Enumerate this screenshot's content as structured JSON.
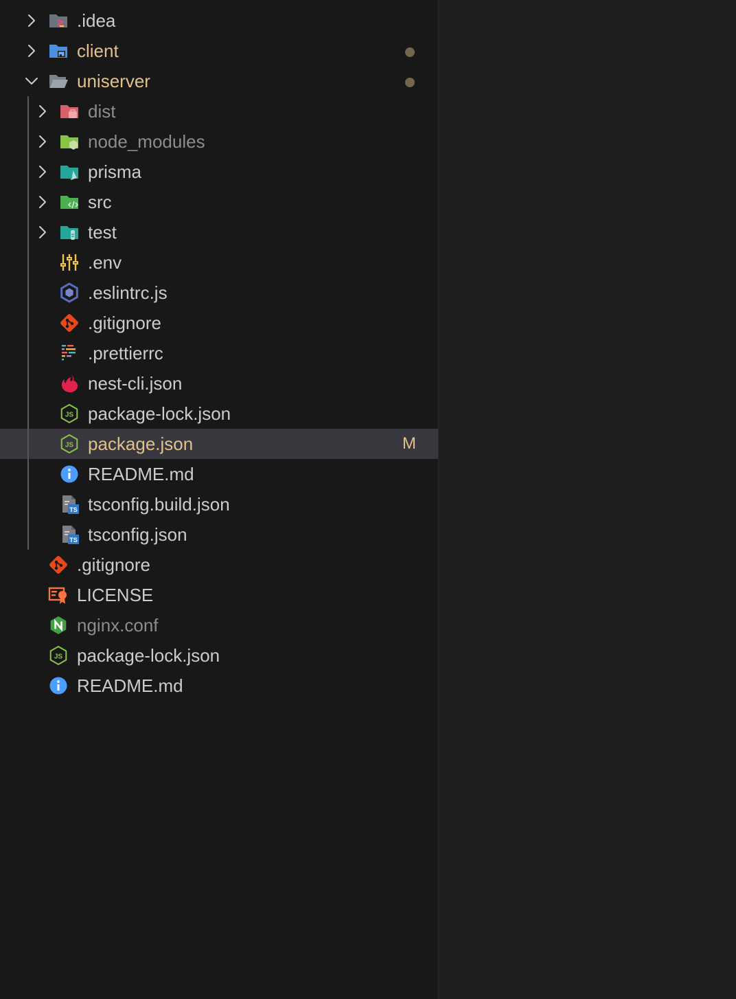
{
  "colors": {
    "sidebar_bg": "#181818",
    "editor_bg": "#1f1f1f",
    "selected_bg": "#37373d",
    "modified_text": "#e2c08d",
    "ignored_text": "#8c8c8c",
    "default_text": "#cccccc",
    "dot": "#73654c"
  },
  "explorer": {
    "items": [
      {
        "label": ".idea",
        "icon": "folder-idea-icon",
        "depth": 0,
        "folder": true,
        "expanded": false,
        "state": "normal"
      },
      {
        "label": "client",
        "icon": "folder-client-icon",
        "depth": 0,
        "folder": true,
        "expanded": false,
        "state": "modified",
        "decoration": "dot"
      },
      {
        "label": "uniserver",
        "icon": "folder-open-icon",
        "depth": 0,
        "folder": true,
        "expanded": true,
        "state": "modified",
        "decoration": "dot"
      },
      {
        "label": "dist",
        "icon": "folder-dist-icon",
        "depth": 1,
        "folder": true,
        "expanded": false,
        "state": "ignored"
      },
      {
        "label": "node_modules",
        "icon": "folder-node-icon",
        "depth": 1,
        "folder": true,
        "expanded": false,
        "state": "ignored"
      },
      {
        "label": "prisma",
        "icon": "folder-prisma-icon",
        "depth": 1,
        "folder": true,
        "expanded": false,
        "state": "normal"
      },
      {
        "label": "src",
        "icon": "folder-src-icon",
        "depth": 1,
        "folder": true,
        "expanded": false,
        "state": "normal"
      },
      {
        "label": "test",
        "icon": "folder-test-icon",
        "depth": 1,
        "folder": true,
        "expanded": false,
        "state": "normal"
      },
      {
        "label": ".env",
        "icon": "env-icon",
        "depth": 1,
        "folder": false,
        "state": "normal"
      },
      {
        "label": ".eslintrc.js",
        "icon": "eslint-icon",
        "depth": 1,
        "folder": false,
        "state": "normal"
      },
      {
        "label": ".gitignore",
        "icon": "git-icon",
        "depth": 1,
        "folder": false,
        "state": "normal"
      },
      {
        "label": ".prettierrc",
        "icon": "prettier-icon",
        "depth": 1,
        "folder": false,
        "state": "normal"
      },
      {
        "label": "nest-cli.json",
        "icon": "nest-icon",
        "depth": 1,
        "folder": false,
        "state": "normal"
      },
      {
        "label": "package-lock.json",
        "icon": "nodejs-icon",
        "depth": 1,
        "folder": false,
        "state": "normal"
      },
      {
        "label": "package.json",
        "icon": "nodejs-icon",
        "depth": 1,
        "folder": false,
        "state": "modified",
        "decoration": "M",
        "selected": true
      },
      {
        "label": "README.md",
        "icon": "info-icon",
        "depth": 1,
        "folder": false,
        "state": "normal"
      },
      {
        "label": "tsconfig.build.json",
        "icon": "tsconfig-icon",
        "depth": 1,
        "folder": false,
        "state": "normal"
      },
      {
        "label": "tsconfig.json",
        "icon": "tsconfig-icon",
        "depth": 1,
        "folder": false,
        "state": "normal"
      },
      {
        "label": ".gitignore",
        "icon": "git-icon",
        "depth": 0,
        "folder": false,
        "state": "normal"
      },
      {
        "label": "LICENSE",
        "icon": "license-icon",
        "depth": 0,
        "folder": false,
        "state": "normal"
      },
      {
        "label": "nginx.conf",
        "icon": "nginx-icon",
        "depth": 0,
        "folder": false,
        "state": "ignored"
      },
      {
        "label": "package-lock.json",
        "icon": "nodejs-icon",
        "depth": 0,
        "folder": false,
        "state": "normal"
      },
      {
        "label": "README.md",
        "icon": "info-icon",
        "depth": 0,
        "folder": false,
        "state": "normal"
      }
    ]
  }
}
